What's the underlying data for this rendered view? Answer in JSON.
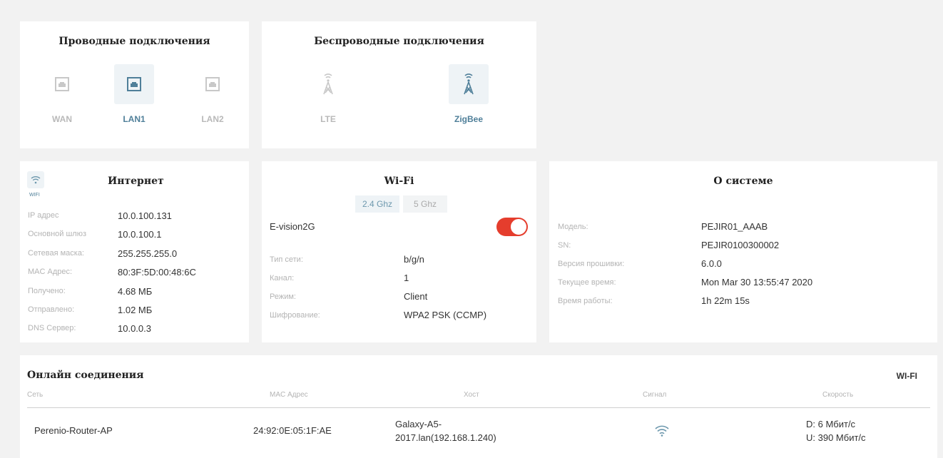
{
  "wired": {
    "title": "Проводные подключения",
    "items": [
      {
        "label": "WAN",
        "icon": "ethernet-port-icon",
        "active": false
      },
      {
        "label": "LAN1",
        "icon": "ethernet-port-icon",
        "active": true
      },
      {
        "label": "LAN2",
        "icon": "ethernet-port-icon",
        "active": false
      }
    ]
  },
  "wireless": {
    "title": "Беспроводные подключения",
    "items": [
      {
        "label": "LTE",
        "icon": "antenna-tower-icon",
        "active": false
      },
      {
        "label": "ZigBee",
        "icon": "antenna-tower-icon",
        "active": true
      }
    ]
  },
  "internet": {
    "title": "Интернет",
    "icon_caption": "WIFI",
    "rows": [
      {
        "label": "IP адрес",
        "value": "10.0.100.131"
      },
      {
        "label": "Основной шлюз",
        "value": "10.0.100.1"
      },
      {
        "label": "Сетевая маска:",
        "value": "255.255.255.0"
      },
      {
        "label": "MAC Адрес:",
        "value": "80:3F:5D:00:48:6C"
      },
      {
        "label": "Получено:",
        "value": "4.68 МБ"
      },
      {
        "label": "Отправлено:",
        "value": "1.02 МБ"
      },
      {
        "label": "DNS Сервер:",
        "value": "10.0.0.3"
      }
    ]
  },
  "wifi": {
    "title": "Wi-Fi",
    "tabs": [
      {
        "label": "2.4 Ghz",
        "active": true
      },
      {
        "label": "5 Ghz",
        "active": false
      }
    ],
    "ssid": "E-vision2G",
    "enabled": true,
    "rows": [
      {
        "label": "Тип сети:",
        "value": "b/g/n"
      },
      {
        "label": "Канал:",
        "value": "1"
      },
      {
        "label": "Режим:",
        "value": "Client"
      },
      {
        "label": "Шифрование:",
        "value": "WPA2 PSK (CCMP)"
      }
    ]
  },
  "system": {
    "title": "О системе",
    "rows": [
      {
        "label": "Модель:",
        "value": "PEJIR01_AAAB"
      },
      {
        "label": "SN:",
        "value": "PEJIR0100300002"
      },
      {
        "label": "Версия прошивки:",
        "value": "6.0.0"
      },
      {
        "label": "Текущее время:",
        "value": "Mon Mar 30 13:55:47 2020"
      },
      {
        "label": "Время работы:",
        "value": "1h 22m 15s"
      }
    ]
  },
  "online": {
    "title": "Онлайн соединения",
    "filter": "WI-FI",
    "columns": [
      "Сеть",
      "MAC Адрес",
      "Хост",
      "Сигнал",
      "Скорость"
    ],
    "rows": [
      {
        "network": "Perenio-Router-AP",
        "mac": "24:92:0E:05:1F:AE",
        "host_line1": "Galaxy-A5-",
        "host_line2": "2017.lan(192.168.1.240)",
        "signal_icon": "wifi-signal-icon",
        "speed_down": "D: 6 Мбит/с",
        "speed_up": "U: 390 Мбит/с"
      }
    ]
  },
  "colors": {
    "accent": "#4f7f99",
    "toggle_on": "#e53d2d",
    "background": "#f2f2f2"
  }
}
